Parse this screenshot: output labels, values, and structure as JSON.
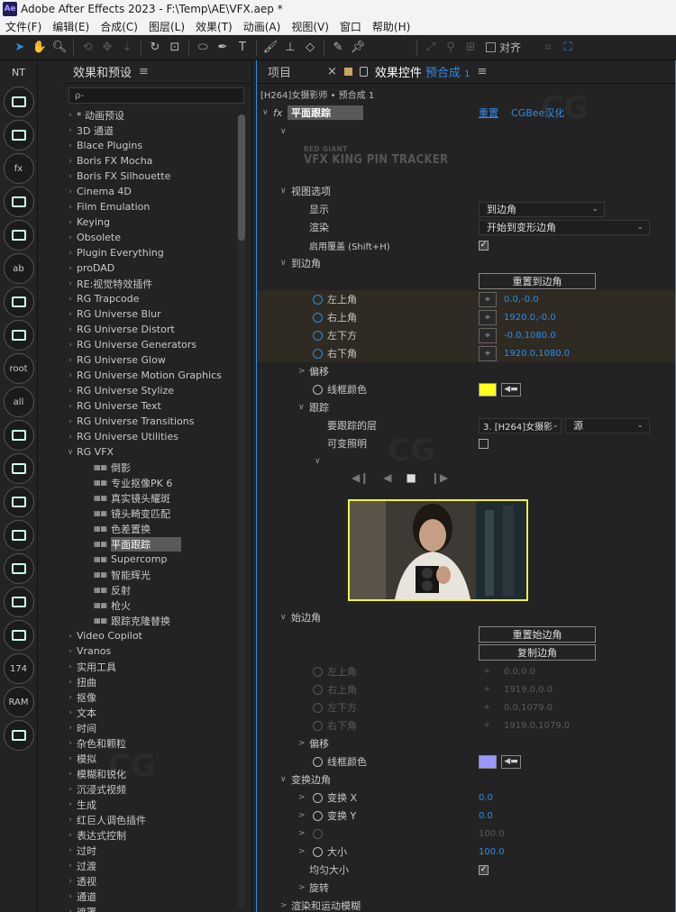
{
  "window": {
    "logo": "Ae",
    "title": "Adobe After Effects 2023 - F:\\Temp\\AE\\VFX.aep *"
  },
  "menu": [
    "文件(F)",
    "编辑(E)",
    "合成(C)",
    "图层(L)",
    "效果(T)",
    "动画(A)",
    "视图(V)",
    "窗口",
    "帮助(H)"
  ],
  "toolbar": {
    "align_label": "对齐"
  },
  "leftbar": {
    "header": "NT",
    "buttons": [
      {
        "icon": "car-icon",
        "text": ""
      },
      {
        "icon": "layers-icon",
        "text": ""
      },
      {
        "icon": "fx-styles-icon",
        "text": "fx"
      },
      {
        "icon": "image-add-icon",
        "text": ""
      },
      {
        "icon": "crosshair-icon",
        "text": ""
      },
      {
        "icon": "ab-icon",
        "text": "ab"
      },
      {
        "icon": "dots-circle-icon",
        "text": ""
      },
      {
        "icon": "grid-icon",
        "text": ""
      },
      {
        "icon": "root-folder-icon",
        "text": "root"
      },
      {
        "icon": "all-folder-icon",
        "text": "all"
      },
      {
        "icon": "lines-icon",
        "text": ""
      },
      {
        "icon": "panels-icon",
        "text": ""
      },
      {
        "icon": "rectangle-icon",
        "text": ""
      },
      {
        "icon": "camera-icon",
        "text": ""
      },
      {
        "icon": "select-box-icon",
        "text": ""
      },
      {
        "icon": "monitor-icon",
        "text": ""
      },
      {
        "icon": "burst-icon",
        "text": ""
      },
      {
        "icon": "counter-icon",
        "text": "174"
      },
      {
        "icon": "ram-icon",
        "text": "RAM"
      },
      {
        "icon": "refresh-icon",
        "text": ""
      }
    ]
  },
  "effects_panel": {
    "title": "效果和预设",
    "search_placeholder": "ρ-",
    "categories": [
      "* 动画预设",
      "3D 通道",
      "Blace Plugins",
      "Boris FX Mocha",
      "Boris FX Silhouette",
      "Cinema 4D",
      "Film Emulation",
      "Keying",
      "Obsolete",
      "Plugin Everything",
      "proDAD",
      "RE:视觉特效插件",
      "RG Trapcode",
      "RG Universe Blur",
      "RG Universe Distort",
      "RG Universe Generators",
      "RG Universe Glow",
      "RG Universe Motion Graphics",
      "RG Universe Stylize",
      "RG Universe Text",
      "RG Universe Transitions",
      "RG Universe Utilities",
      "RG VFX"
    ],
    "rg_vfx_children": [
      "倒影",
      "专业抠像PK 6",
      "真实镜头耀斑",
      "镜头畸变匹配",
      "色差置换",
      "平面跟踪",
      "Supercomp",
      "智能辉光",
      "反射",
      "枪火",
      "跟踪克隆替换"
    ],
    "selected_child": "平面跟踪",
    "categories_after": [
      "Video Copilot",
      "Vranos",
      "实用工具",
      "扭曲",
      "抠像",
      "文本",
      "时间",
      "杂色和颗粒",
      "模拟",
      "模糊和锐化",
      "沉浸式视频",
      "生成",
      "红巨人调色插件",
      "表达式控制",
      "过时",
      "过渡",
      "透视",
      "通道",
      "遮罩"
    ]
  },
  "effect_controls": {
    "tab_project": "项目",
    "tab_close": "×",
    "tab_title": "效果控件",
    "tab_comp": "预合成",
    "tab_comp_num": "1",
    "subtitle": "[H264]女摄影师 • 预合成 1",
    "effect_name": "平面跟踪",
    "reset_link": "重置",
    "cgbee_link": "CGBee汉化",
    "brand_top": "RED GIANT",
    "brand_main": "VFX KING PIN TRACKER",
    "view_options": "视图选项",
    "display_label": "显示",
    "display_value": "到边角",
    "render_label": "渲染",
    "render_value": "开始到变形边角",
    "overlay_label": "启用覆盖 (Shift+H)",
    "to_corners": "到边角",
    "reset_to_corners": "重置到边角",
    "tl_label": "左上角",
    "tl_value": "0.0,-0.0",
    "tr_label": "右上角",
    "tr_value": "1920.0,-0.0",
    "bl_label": "左下方",
    "bl_value": "-0.0,1080.0",
    "br_label": "右下角",
    "br_value": "1920.0,1080.0",
    "offset_label": "偏移",
    "wire_color_label": "线框颜色",
    "wire_color_1": "#ffff22",
    "tracking": "跟踪",
    "track_layer_label": "要跟踪的层",
    "track_layer_value": "3. [H264]女摄影",
    "source_value": "源",
    "var_light_label": "可变照明",
    "from_corners": "始边角",
    "reset_from_corners": "重置始边角",
    "copy_corners": "复制边角",
    "ftl_label": "左上角",
    "ftl_value": "0.0,0.0",
    "ftr_label": "右上角",
    "ftr_value": "1919.0,0.0",
    "fbl_label": "左下方",
    "fbl_value": "0.0,1079.0",
    "fbr_label": "右下角",
    "fbr_value": "1919.0,1079.0",
    "offset2_label": "偏移",
    "wire_color2_label": "线框颜色",
    "wire_color_2": "#9898ff",
    "transform_corners": "变换边角",
    "tx_label": "变换 X",
    "tx_value": "0.0",
    "ty_label": "变换 Y",
    "ty_value": "0.0",
    "disabled_value": "100.0",
    "size_label": "大小",
    "size_value": "100.0",
    "uniform_label": "均匀大小",
    "rotate_label": "旋转",
    "render_motion_label": "渲染和运动模糊"
  },
  "watermark": "CG"
}
